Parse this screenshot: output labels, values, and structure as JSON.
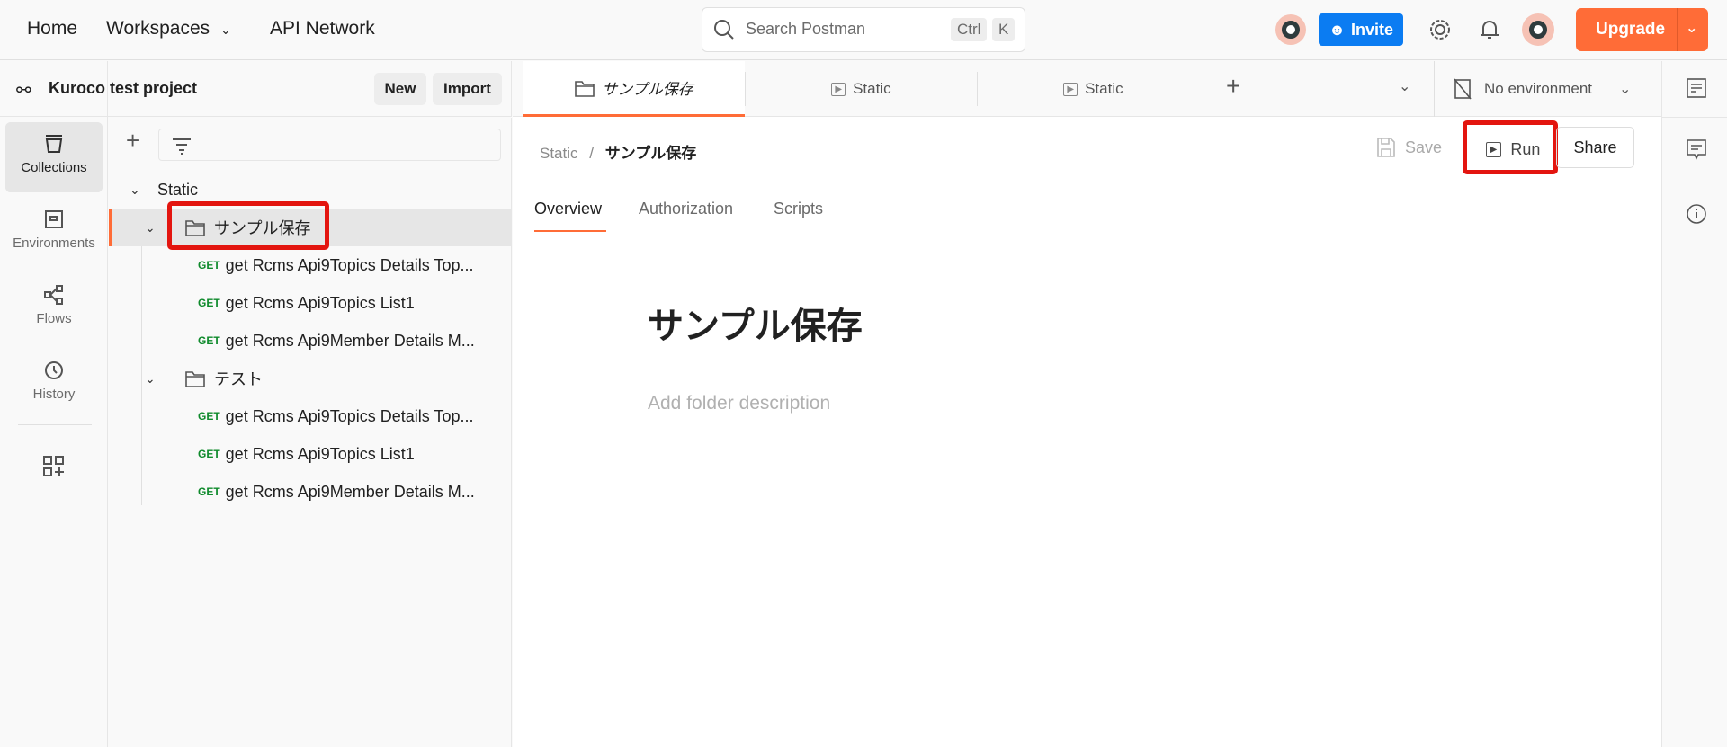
{
  "topbar": {
    "home": "Home",
    "workspaces": "Workspaces",
    "api_network": "API Network",
    "search_placeholder": "Search Postman",
    "shortcut_ctrl": "Ctrl",
    "shortcut_k": "K",
    "invite": "Invite",
    "upgrade": "Upgrade"
  },
  "colors": {
    "accent": "#ff6c37",
    "invite": "#0b7cf2",
    "get": "#0f8a2c",
    "highlight": "#e3150f"
  },
  "rail": [
    {
      "label": "Collections",
      "icon": "collections-icon"
    },
    {
      "label": "Environments",
      "icon": "environments-icon"
    },
    {
      "label": "Flows",
      "icon": "flows-icon"
    },
    {
      "label": "History",
      "icon": "history-icon"
    }
  ],
  "sidebar": {
    "workspace": "Kuroco test project",
    "new": "New",
    "import": "Import",
    "collection": "Static",
    "folders": [
      {
        "name": "サンプル保存",
        "requests": [
          {
            "method": "GET",
            "name": "get Rcms Api9Topics Details Top..."
          },
          {
            "method": "GET",
            "name": "get Rcms Api9Topics List1"
          },
          {
            "method": "GET",
            "name": "get Rcms Api9Member Details M..."
          }
        ]
      },
      {
        "name": "テスト",
        "requests": [
          {
            "method": "GET",
            "name": "get Rcms Api9Topics Details Top..."
          },
          {
            "method": "GET",
            "name": "get Rcms Api9Topics List1"
          },
          {
            "method": "GET",
            "name": "get Rcms Api9Member Details M..."
          }
        ]
      }
    ]
  },
  "tabs": [
    {
      "label": "サンプル保存"
    },
    {
      "label": "Static"
    },
    {
      "label": "Static"
    }
  ],
  "environment": "No environment",
  "breadcrumb": {
    "parent": "Static",
    "sep": "/",
    "current": "サンプル保存"
  },
  "actions": {
    "save": "Save",
    "run": "Run",
    "share": "Share"
  },
  "subtabs": [
    "Overview",
    "Authorization",
    "Scripts"
  ],
  "content": {
    "title": "サンプル保存",
    "description_placeholder": "Add folder description"
  }
}
